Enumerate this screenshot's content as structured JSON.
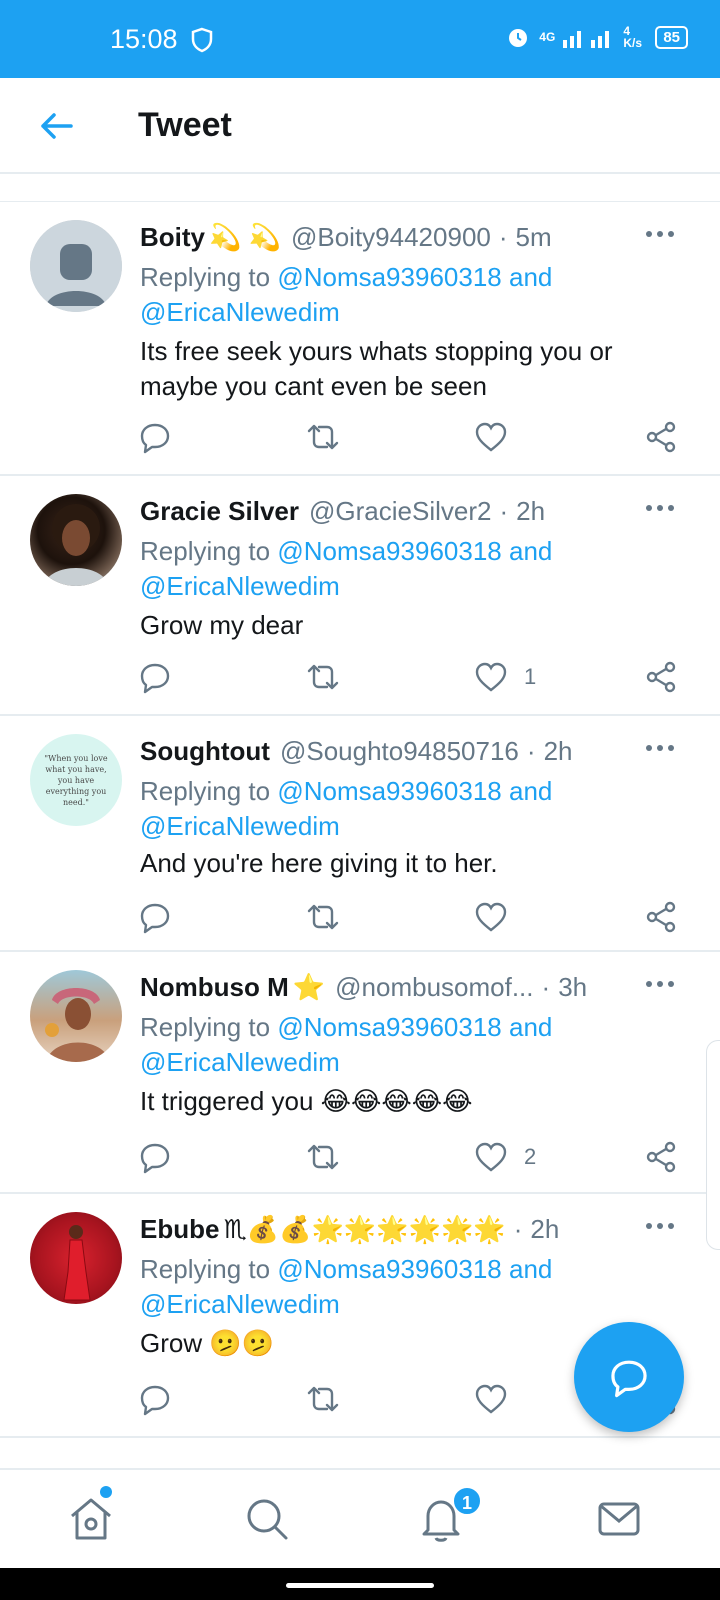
{
  "status_bar": {
    "time": "15:08",
    "network": "4G",
    "speed": "4 K/s",
    "battery": "85"
  },
  "app_bar": {
    "title": "Tweet"
  },
  "tweets": [
    {
      "name": "Boity",
      "name_emoji": "💫 💫",
      "handle": "@Boity94420900",
      "time": "5m",
      "replying_prefix": "Replying to",
      "reply_to_1": "@Nomsa93960318",
      "reply_and": "and",
      "reply_to_2": "@EricaNlewedim",
      "text": "Its free seek yours whats stopping you or maybe you cant even be seen",
      "like_count": ""
    },
    {
      "name": "Gracie Silver",
      "name_emoji": "",
      "handle": "@GracieSilver2",
      "time": "2h",
      "replying_prefix": "Replying to",
      "reply_to_1": "@Nomsa93960318",
      "reply_and": "and",
      "reply_to_2": "@EricaNlewedim",
      "text": "Grow my dear",
      "like_count": "1"
    },
    {
      "name": "Soughtout",
      "name_emoji": "",
      "handle": "@Soughto94850716",
      "time": "2h",
      "replying_prefix": "Replying to",
      "reply_to_1": "@Nomsa93960318",
      "reply_and": "and",
      "reply_to_2": "@EricaNlewedim",
      "text": "And you're here giving it to her.",
      "like_count": "",
      "avatar_text": "\"When you love what you have, you have everything you need.\""
    },
    {
      "name": "Nombuso M",
      "name_emoji": "⭐",
      "handle": "@nombusomof...",
      "time": "3h",
      "replying_prefix": "Replying to",
      "reply_to_1": "@Nomsa93960318",
      "reply_and": "and",
      "reply_to_2": "@EricaNlewedim",
      "text": "It triggered you 😂😂😂😂😂",
      "like_count": "2"
    },
    {
      "name": "Ebube",
      "name_emoji": "♏💰💰🌟🌟🌟🌟🌟🌟",
      "handle": "",
      "time": "2h",
      "replying_prefix": "Replying to",
      "reply_to_1": "@Nomsa93960318",
      "reply_and": "and",
      "reply_to_2": "@EricaNlewedim",
      "text": "Grow 🫤🫤",
      "like_count": ""
    }
  ],
  "bottom_nav": {
    "items": [
      "home",
      "search",
      "notifications",
      "messages"
    ],
    "notification_badge": "1"
  },
  "colors": {
    "accent": "#1da1f2",
    "text": "#14171a",
    "secondary": "#657786",
    "divider": "#e6ecf0"
  }
}
